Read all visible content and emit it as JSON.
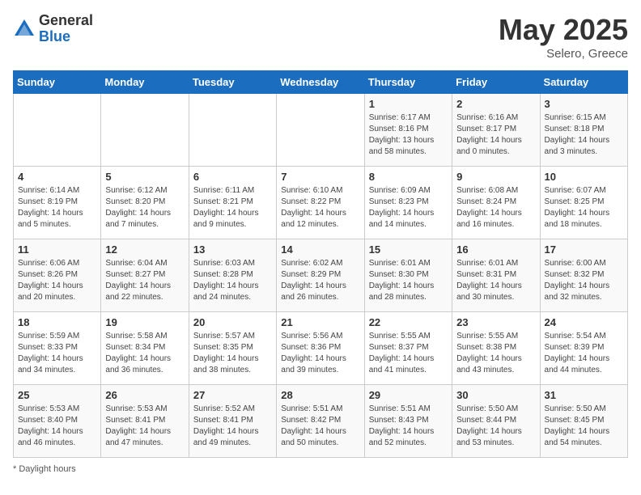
{
  "header": {
    "logo_general": "General",
    "logo_blue": "Blue",
    "month": "May 2025",
    "location": "Selero, Greece"
  },
  "days_of_week": [
    "Sunday",
    "Monday",
    "Tuesday",
    "Wednesday",
    "Thursday",
    "Friday",
    "Saturday"
  ],
  "weeks": [
    [
      {
        "day": "",
        "info": ""
      },
      {
        "day": "",
        "info": ""
      },
      {
        "day": "",
        "info": ""
      },
      {
        "day": "",
        "info": ""
      },
      {
        "day": "1",
        "info": "Sunrise: 6:17 AM\nSunset: 8:16 PM\nDaylight: 13 hours\nand 58 minutes."
      },
      {
        "day": "2",
        "info": "Sunrise: 6:16 AM\nSunset: 8:17 PM\nDaylight: 14 hours\nand 0 minutes."
      },
      {
        "day": "3",
        "info": "Sunrise: 6:15 AM\nSunset: 8:18 PM\nDaylight: 14 hours\nand 3 minutes."
      }
    ],
    [
      {
        "day": "4",
        "info": "Sunrise: 6:14 AM\nSunset: 8:19 PM\nDaylight: 14 hours\nand 5 minutes."
      },
      {
        "day": "5",
        "info": "Sunrise: 6:12 AM\nSunset: 8:20 PM\nDaylight: 14 hours\nand 7 minutes."
      },
      {
        "day": "6",
        "info": "Sunrise: 6:11 AM\nSunset: 8:21 PM\nDaylight: 14 hours\nand 9 minutes."
      },
      {
        "day": "7",
        "info": "Sunrise: 6:10 AM\nSunset: 8:22 PM\nDaylight: 14 hours\nand 12 minutes."
      },
      {
        "day": "8",
        "info": "Sunrise: 6:09 AM\nSunset: 8:23 PM\nDaylight: 14 hours\nand 14 minutes."
      },
      {
        "day": "9",
        "info": "Sunrise: 6:08 AM\nSunset: 8:24 PM\nDaylight: 14 hours\nand 16 minutes."
      },
      {
        "day": "10",
        "info": "Sunrise: 6:07 AM\nSunset: 8:25 PM\nDaylight: 14 hours\nand 18 minutes."
      }
    ],
    [
      {
        "day": "11",
        "info": "Sunrise: 6:06 AM\nSunset: 8:26 PM\nDaylight: 14 hours\nand 20 minutes."
      },
      {
        "day": "12",
        "info": "Sunrise: 6:04 AM\nSunset: 8:27 PM\nDaylight: 14 hours\nand 22 minutes."
      },
      {
        "day": "13",
        "info": "Sunrise: 6:03 AM\nSunset: 8:28 PM\nDaylight: 14 hours\nand 24 minutes."
      },
      {
        "day": "14",
        "info": "Sunrise: 6:02 AM\nSunset: 8:29 PM\nDaylight: 14 hours\nand 26 minutes."
      },
      {
        "day": "15",
        "info": "Sunrise: 6:01 AM\nSunset: 8:30 PM\nDaylight: 14 hours\nand 28 minutes."
      },
      {
        "day": "16",
        "info": "Sunrise: 6:01 AM\nSunset: 8:31 PM\nDaylight: 14 hours\nand 30 minutes."
      },
      {
        "day": "17",
        "info": "Sunrise: 6:00 AM\nSunset: 8:32 PM\nDaylight: 14 hours\nand 32 minutes."
      }
    ],
    [
      {
        "day": "18",
        "info": "Sunrise: 5:59 AM\nSunset: 8:33 PM\nDaylight: 14 hours\nand 34 minutes."
      },
      {
        "day": "19",
        "info": "Sunrise: 5:58 AM\nSunset: 8:34 PM\nDaylight: 14 hours\nand 36 minutes."
      },
      {
        "day": "20",
        "info": "Sunrise: 5:57 AM\nSunset: 8:35 PM\nDaylight: 14 hours\nand 38 minutes."
      },
      {
        "day": "21",
        "info": "Sunrise: 5:56 AM\nSunset: 8:36 PM\nDaylight: 14 hours\nand 39 minutes."
      },
      {
        "day": "22",
        "info": "Sunrise: 5:55 AM\nSunset: 8:37 PM\nDaylight: 14 hours\nand 41 minutes."
      },
      {
        "day": "23",
        "info": "Sunrise: 5:55 AM\nSunset: 8:38 PM\nDaylight: 14 hours\nand 43 minutes."
      },
      {
        "day": "24",
        "info": "Sunrise: 5:54 AM\nSunset: 8:39 PM\nDaylight: 14 hours\nand 44 minutes."
      }
    ],
    [
      {
        "day": "25",
        "info": "Sunrise: 5:53 AM\nSunset: 8:40 PM\nDaylight: 14 hours\nand 46 minutes."
      },
      {
        "day": "26",
        "info": "Sunrise: 5:53 AM\nSunset: 8:41 PM\nDaylight: 14 hours\nand 47 minutes."
      },
      {
        "day": "27",
        "info": "Sunrise: 5:52 AM\nSunset: 8:41 PM\nDaylight: 14 hours\nand 49 minutes."
      },
      {
        "day": "28",
        "info": "Sunrise: 5:51 AM\nSunset: 8:42 PM\nDaylight: 14 hours\nand 50 minutes."
      },
      {
        "day": "29",
        "info": "Sunrise: 5:51 AM\nSunset: 8:43 PM\nDaylight: 14 hours\nand 52 minutes."
      },
      {
        "day": "30",
        "info": "Sunrise: 5:50 AM\nSunset: 8:44 PM\nDaylight: 14 hours\nand 53 minutes."
      },
      {
        "day": "31",
        "info": "Sunrise: 5:50 AM\nSunset: 8:45 PM\nDaylight: 14 hours\nand 54 minutes."
      }
    ]
  ],
  "footer": {
    "note": "Daylight hours"
  }
}
